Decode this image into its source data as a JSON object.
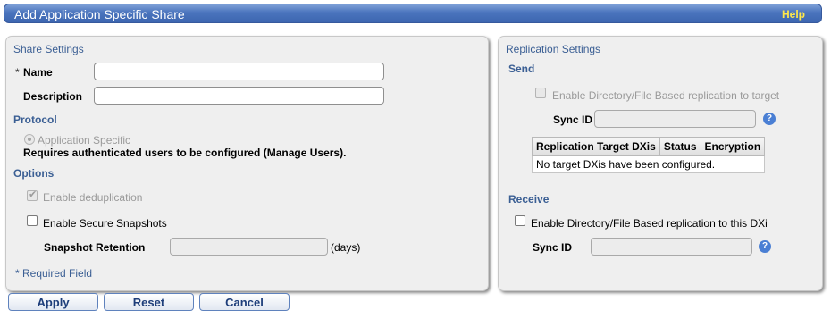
{
  "title_bar": {
    "title": "Add Application Specific Share",
    "help": "Help"
  },
  "share_settings": {
    "heading": "Share Settings",
    "name_star": "*",
    "name_label": "Name",
    "name_value": "",
    "description_label": "Description",
    "description_value": "",
    "protocol_heading": "Protocol",
    "protocol_option": "Application Specific",
    "protocol_note": "Requires authenticated users to be configured (Manage Users).",
    "options_heading": "Options",
    "dedup_label": "Enable deduplication",
    "secure_snapshots_label": "Enable Secure Snapshots",
    "snapshot_retention_label": "Snapshot Retention",
    "snapshot_retention_value": "",
    "days_label": "(days)",
    "required_note": "* Required Field"
  },
  "replication_settings": {
    "heading": "Replication Settings",
    "send_heading": "Send",
    "send_enable_label": "Enable Directory/File Based replication to target",
    "send_sync_id_label": "Sync ID",
    "send_sync_id_value": "",
    "table": {
      "columns": [
        "Replication Target DXis",
        "Status",
        "Encryption"
      ],
      "empty_message": "No target DXis have been configured."
    },
    "receive_heading": "Receive",
    "receive_enable_label": "Enable Directory/File Based replication to this DXi",
    "receive_sync_id_label": "Sync ID",
    "receive_sync_id_value": "",
    "help_glyph": "?"
  },
  "buttons": {
    "apply": "Apply",
    "reset": "Reset",
    "cancel": "Cancel"
  }
}
